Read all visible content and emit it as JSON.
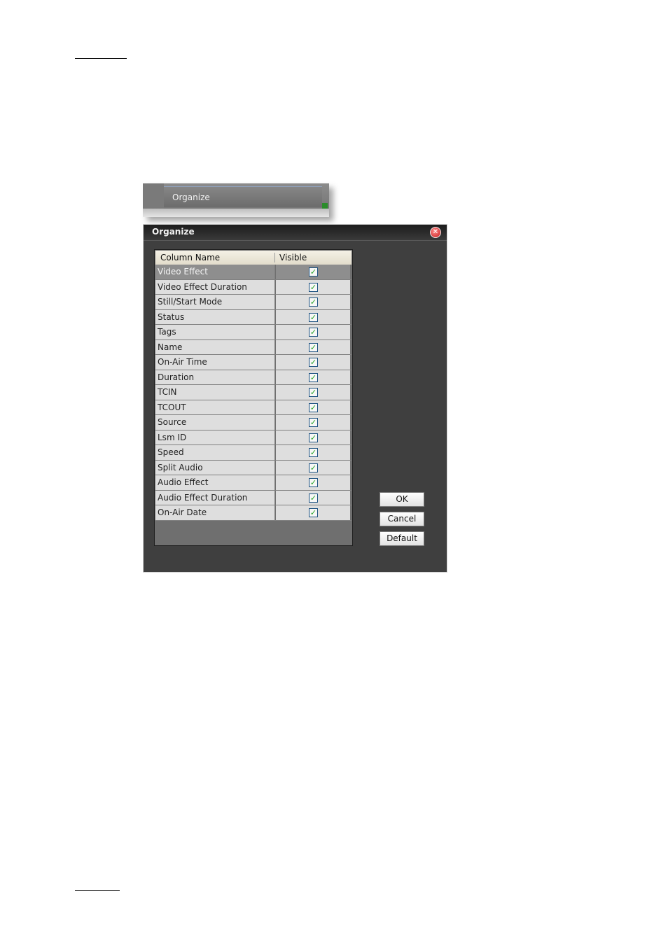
{
  "context_menu": {
    "item_label": "Organize"
  },
  "dialog": {
    "title": "Organize",
    "close_glyph": "✕",
    "table": {
      "headers": {
        "name": "Column Name",
        "visible": "Visible"
      },
      "rows": [
        {
          "name": "Video Effect",
          "visible": true,
          "selected": true
        },
        {
          "name": "Video Effect Duration",
          "visible": true
        },
        {
          "name": "Still/Start Mode",
          "visible": true
        },
        {
          "name": "Status",
          "visible": true
        },
        {
          "name": "Tags",
          "visible": true
        },
        {
          "name": "Name",
          "visible": true
        },
        {
          "name": "On-Air Time",
          "visible": true
        },
        {
          "name": "Duration",
          "visible": true
        },
        {
          "name": "TCIN",
          "visible": true
        },
        {
          "name": "TCOUT",
          "visible": true
        },
        {
          "name": "Source",
          "visible": true
        },
        {
          "name": "Lsm ID",
          "visible": true
        },
        {
          "name": "Speed",
          "visible": true
        },
        {
          "name": "Split Audio",
          "visible": true
        },
        {
          "name": "Audio Effect",
          "visible": true
        },
        {
          "name": "Audio Effect Duration",
          "visible": true
        },
        {
          "name": "On-Air Date",
          "visible": true
        }
      ]
    },
    "buttons": {
      "ok": "OK",
      "cancel": "Cancel",
      "default": "Default"
    }
  }
}
